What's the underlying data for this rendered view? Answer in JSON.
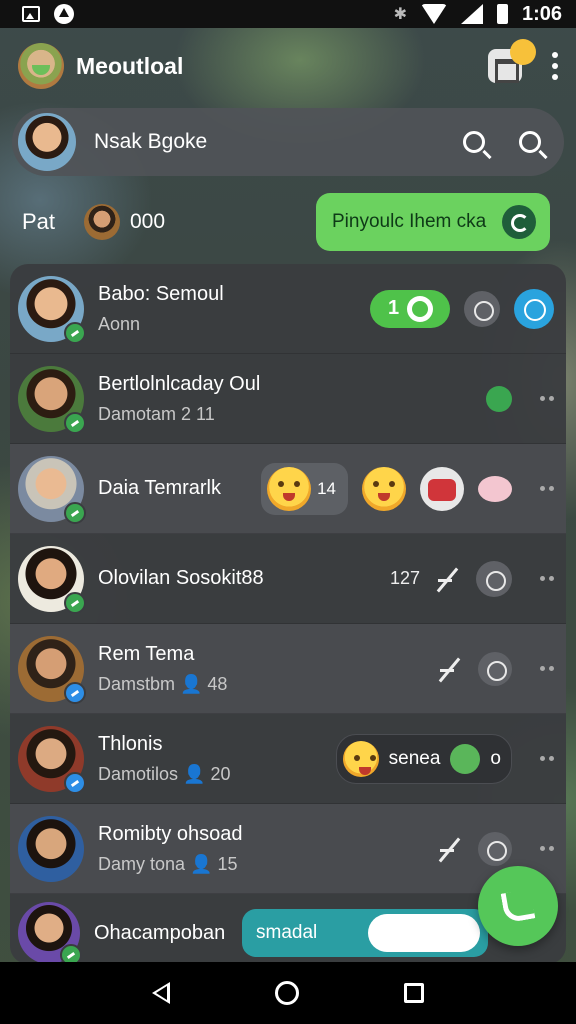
{
  "status_bar": {
    "time": "1:06",
    "bt_glyph": "✱"
  },
  "header": {
    "title": "Meoutloal"
  },
  "search": {
    "name": "Nsak Bgoke"
  },
  "sub_row": {
    "label": "Pat",
    "count": "000",
    "action_label": "Pinyoulc Ihem cka"
  },
  "chats": [
    {
      "name": "Babo: Semoul",
      "sub": "Aonn",
      "unread": "1"
    },
    {
      "name": "Bertlolnlcaday Oul",
      "sub": "Damotam 2 11"
    },
    {
      "name": "Daia Temrarlk",
      "chip_text": "14"
    },
    {
      "name": "Olovilan Sosokit88",
      "meta": "127"
    },
    {
      "name": "Rem Tema",
      "sub": "Damstbm 👤 48"
    },
    {
      "name": "Thlonis",
      "sub": "Damotilos 👤 20",
      "reaction_text": "senea",
      "reaction_count": "o"
    },
    {
      "name": "Romibty ohsoad",
      "sub": "Damy tona 👤 15"
    }
  ],
  "last_chat": {
    "name": "Ohacampoban",
    "input_value": "smadal"
  },
  "icons": {
    "logo": "app-logo",
    "search": "search-icon",
    "new_chat": "new-chat-icon",
    "fab": "phone-icon"
  },
  "colors": {
    "accent_green": "#55c759",
    "pill_green": "#6bd25f",
    "teal": "#2a9ea3",
    "blue": "#2aa3de"
  }
}
